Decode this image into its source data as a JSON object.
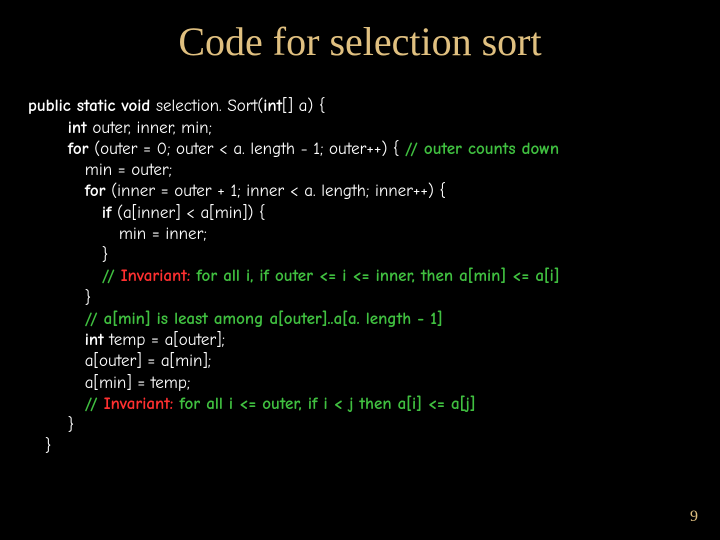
{
  "title": "Code for selection sort",
  "code": {
    "l1a": "public static void",
    "l1b": " selection. Sort(",
    "l1c": "int",
    "l1d": "[] a) {",
    "l2a": "int",
    "l2b": " outer, inner, min;",
    "l3a": "for",
    "l3b": " (outer = 0; outer < a. length - 1; outer++) { ",
    "l3c": "// outer counts down",
    "l4": "min = outer;",
    "l5a": "for",
    "l5b": " (inner = outer + 1; inner < a. length; inner++) {",
    "l6a": "if",
    "l6b": " (a[inner] < a[min]) {",
    "l7": "min = inner;",
    "l8": "}",
    "l9a": "// ",
    "l9b": "Invariant:",
    "l9c": " for all i, if outer <= i <= inner, then a[min] <= a[i]",
    "l10": "}",
    "l11": "// a[min] is least among a[outer]..a[a. length - 1]",
    "l12a": "int",
    "l12b": " temp = a[outer];",
    "l13": "a[outer] = a[min];",
    "l14": "a[min] = temp;",
    "l15a": "// ",
    "l15b": "Invariant:",
    "l15c": " for all i <= outer, if i < j then a[i] <= a[j]",
    "l16": "}",
    "l17": "}"
  },
  "pagenum": "9"
}
